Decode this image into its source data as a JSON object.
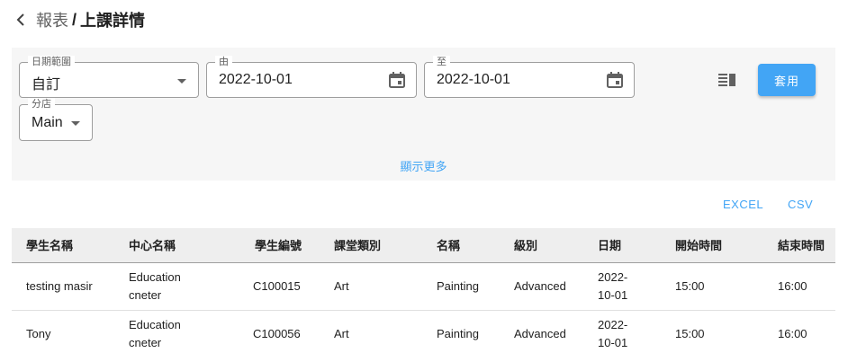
{
  "header": {
    "back_icon": "chevron-left-icon",
    "breadcrumb_parent": "報表",
    "breadcrumb_separator": "/",
    "breadcrumb_current": "上課詳情"
  },
  "filters": {
    "date_range": {
      "label": "日期範圍",
      "value": "自訂"
    },
    "from": {
      "label": "由",
      "value": "2022-10-01"
    },
    "to": {
      "label": "至",
      "value": "2022-10-01"
    },
    "branch": {
      "label": "分店",
      "value": "Main"
    },
    "columns_icon": "view-columns-icon",
    "apply_label": "套用",
    "show_more_label": "顯示更多"
  },
  "export": {
    "excel_label": "EXCEL",
    "csv_label": "CSV"
  },
  "colors": {
    "accent": "#42a5f5",
    "panel_bg": "#f6f6f6",
    "header_bg": "#eeeeee"
  },
  "table": {
    "columns": [
      "學生名稱",
      "中心名稱",
      "學生編號",
      "課堂類別",
      "名稱",
      "級別",
      "日期",
      "開始時間",
      "結束時間"
    ],
    "rows": [
      {
        "student": "testing masir",
        "center_l1": "Education",
        "center_l2": "cneter",
        "student_no": "C100015",
        "category": "Art",
        "name": "Painting",
        "level": "Advanced",
        "date_l1": "2022-",
        "date_l2": "10-01",
        "start": "15:00",
        "end": "16:00"
      },
      {
        "student": "Tony",
        "center_l1": "Education",
        "center_l2": "cneter",
        "student_no": "C100056",
        "category": "Art",
        "name": "Painting",
        "level": "Advanced",
        "date_l1": "2022-",
        "date_l2": "10-01",
        "start": "15:00",
        "end": "16:00"
      }
    ]
  }
}
